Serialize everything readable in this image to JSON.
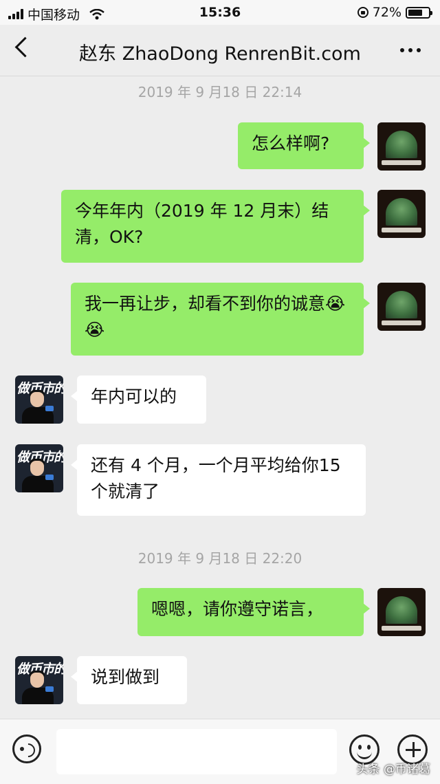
{
  "status_bar": {
    "carrier": "中国移动",
    "time": "15:36",
    "battery": "72%",
    "battery_level": 0.72,
    "icons": [
      "signal-icon",
      "wifi-icon",
      "orientation-lock-icon",
      "battery-icon"
    ]
  },
  "header": {
    "title": "赵东 ZhaoDong RenrenBit.com",
    "back_icon": "chevron-left-icon",
    "more_icon": "more-dots-icon"
  },
  "messages": {
    "stamp1": "2019 年 9 月18 日 22:14",
    "m1": "怎么样啊?",
    "m2": "今年年内（2019 年 12 月末）结清，OK?",
    "m3": "我一再让步，却看不到你的诚意😭😭",
    "m4": "年内可以的",
    "m5": "还有 4 个月，一个月平均给你15 个就清了",
    "stamp2": "2019 年 9 月18 日 22:20",
    "m6": "嗯嗯，请你遵守诺言，",
    "m7": "说到做到"
  },
  "input_bar": {
    "placeholder": "",
    "icons": [
      "voice-icon",
      "emoji-icon",
      "plus-icon"
    ]
  },
  "watermark": "头条 @币诸葛",
  "colors": {
    "background": "#ededed",
    "my_bubble": "#95ec69",
    "their_bubble": "#ffffff",
    "timestamp": "#a5a5a5"
  }
}
